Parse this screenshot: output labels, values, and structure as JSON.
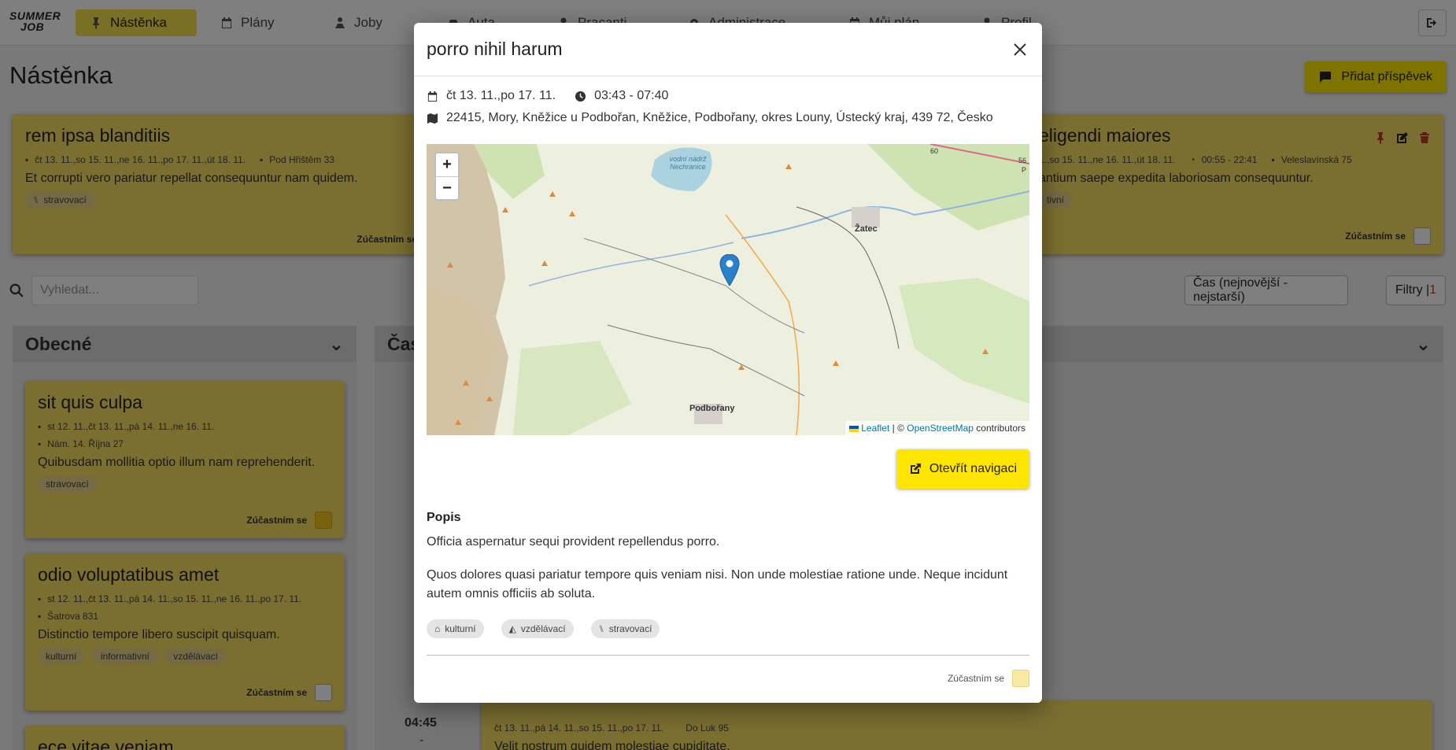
{
  "app": {
    "logo_top": "SUMMER",
    "logo_bottom": "JOB"
  },
  "nav": {
    "items": [
      {
        "label": "Nástěnka",
        "icon": "pin-icon",
        "active": true
      },
      {
        "label": "Plány",
        "icon": "calendar-icon"
      },
      {
        "label": "Joby",
        "icon": "worker-icon"
      },
      {
        "label": "Auta",
        "icon": "car-icon"
      },
      {
        "label": "Pracanti",
        "icon": "user-icon"
      },
      {
        "label": "Administrace",
        "icon": "gears-icon"
      },
      {
        "label": "Můj plán",
        "icon": "calendar-icon"
      },
      {
        "label": "Profil",
        "icon": "user-icon"
      }
    ]
  },
  "page": {
    "title": "Nástěnka",
    "add_post_label": "Přidat příspěvek",
    "search_placeholder": "Vyhledat...",
    "sort_label": "Čas (nejnovější - nejstarší)",
    "filter_label": "Filtry | ",
    "filter_count": "1",
    "participate_label": "Zúčastním se"
  },
  "pinned_cards": [
    {
      "title": "rem ipsa blanditiis",
      "dates": "čt 13. 11.,so 15. 11.,ne 16. 11.,po 17. 11.,út 18. 11.",
      "address": "Pod Hřištěm 33",
      "description": "Et corrupti vero pariatur repellat consequuntur nam quidem.",
      "tags": [
        "stravovací"
      ]
    },
    {
      "title": "eligendi maiores",
      "dates": "1.,so 15. 11.,ne 16. 11.,út 18. 11.",
      "time": "00:55 - 22:41",
      "address": "Veleslavínská 75",
      "description": "antium saepe expedita laboriosam consequuntur.",
      "tags": [
        "tivní"
      ]
    }
  ],
  "columns": {
    "general": "Obecné",
    "timed": "Čas"
  },
  "general_cards": [
    {
      "title": "sit quis culpa",
      "dates": "st 12. 11.,čt 13. 11.,pá 14. 11.,ne 16. 11.",
      "address": "Nám. 14. Října 27",
      "description": "Quibusdam mollitia optio illum nam reprehenderit.",
      "tags": [
        "stravovací"
      ]
    },
    {
      "title": "odio voluptatibus amet",
      "dates": "st 12. 11.,čt 13. 11.,pá 14. 11.,so 15. 11.,ne 16. 11.,po 17. 11.",
      "address": "Šatrova 831",
      "description": "Distinctio tempore libero suscipit quisquam.",
      "tags": [
        "kulturní",
        "informativní",
        "vzdělávací"
      ]
    },
    {
      "title": "ece vitae veniam"
    }
  ],
  "timed_partial": {
    "time": "04:45",
    "dash": "-",
    "dates": "čt 13. 11.,pá 14. 11.,so 15. 11.,po 17. 11.",
    "address": "Do Luk 95",
    "description": "Velit nostrum quidem molestiae cupiditate.",
    "left_times": [
      "0",
      "0",
      "0",
      "0"
    ]
  },
  "modal": {
    "title": "porro nihil harum",
    "dates": "čt 13. 11.,po 17. 11.",
    "time": "03:43 - 07:40",
    "address": "22415, Mory, Kněžice u Podbořan, Kněžice, Podbořany, okres Louny, Ústecký kraj, 439 72, Česko",
    "map": {
      "zoom_in": "+",
      "zoom_out": "−",
      "labels": [
        "vodní nádrž Nechranice",
        "Žatec",
        "Podbořany",
        "60",
        "56",
        "P"
      ],
      "attribution_leaflet": "Leaflet",
      "attribution_sep": " | © ",
      "attribution_osm": "OpenStreetMap",
      "attribution_tail": " contributors"
    },
    "open_nav_label": "Otevřít navigaci",
    "section_title": "Popis",
    "para1": "Officia aspernatur sequi provident repellendus porro.",
    "para2": "Quos dolores quasi pariatur tempore quis veniam nisi. Non unde molestiae ratione unde. Neque incidunt autem omnis officiis ab soluta.",
    "tags": [
      "kulturní",
      "vzdělávací",
      "stravovací"
    ],
    "participate_label": "Zúčastním se"
  },
  "colors": {
    "accent": "#ffe600",
    "card": "#f5dc63",
    "danger": "#c0392b",
    "link": "#0078a8",
    "marker": "#2a81cb"
  }
}
